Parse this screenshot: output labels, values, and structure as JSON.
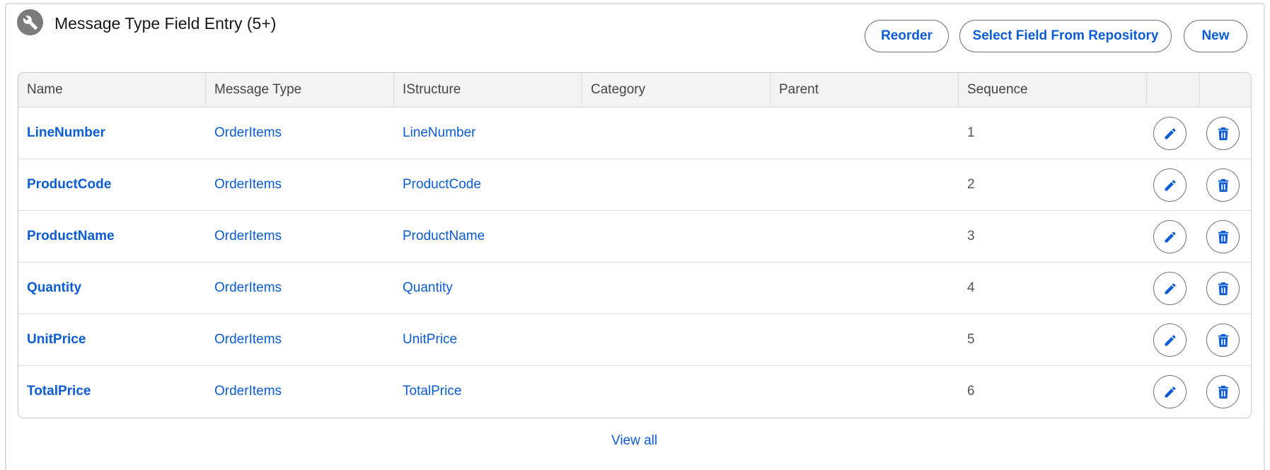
{
  "header": {
    "title": "Message Type Field Entry (5+)",
    "icon": "wrench-icon"
  },
  "actions": {
    "reorder_label": "Reorder",
    "select_label": "Select Field From Repository",
    "new_label": "New"
  },
  "table": {
    "columns": [
      "Name",
      "Message Type",
      "IStructure",
      "Category",
      "Parent",
      "Sequence"
    ],
    "rows": [
      {
        "name": "LineNumber",
        "message_type": "OrderItems",
        "istructure": "LineNumber",
        "category": "",
        "parent": "",
        "sequence": "1"
      },
      {
        "name": "ProductCode",
        "message_type": "OrderItems",
        "istructure": "ProductCode",
        "category": "",
        "parent": "",
        "sequence": "2"
      },
      {
        "name": "ProductName",
        "message_type": "OrderItems",
        "istructure": "ProductName",
        "category": "",
        "parent": "",
        "sequence": "3"
      },
      {
        "name": "Quantity",
        "message_type": "OrderItems",
        "istructure": "Quantity",
        "category": "",
        "parent": "",
        "sequence": "4"
      },
      {
        "name": "UnitPrice",
        "message_type": "OrderItems",
        "istructure": "UnitPrice",
        "category": "",
        "parent": "",
        "sequence": "5"
      },
      {
        "name": "TotalPrice",
        "message_type": "OrderItems",
        "istructure": "TotalPrice",
        "category": "",
        "parent": "",
        "sequence": "6"
      }
    ],
    "row_actions": {
      "edit_icon": "pencil-icon",
      "delete_icon": "trash-icon"
    }
  },
  "footer": {
    "view_all_label": "View all"
  },
  "colors": {
    "accent": "#0b5cd5",
    "header_bg": "#f3f3f3",
    "icon_bg": "#7b7b7b"
  }
}
